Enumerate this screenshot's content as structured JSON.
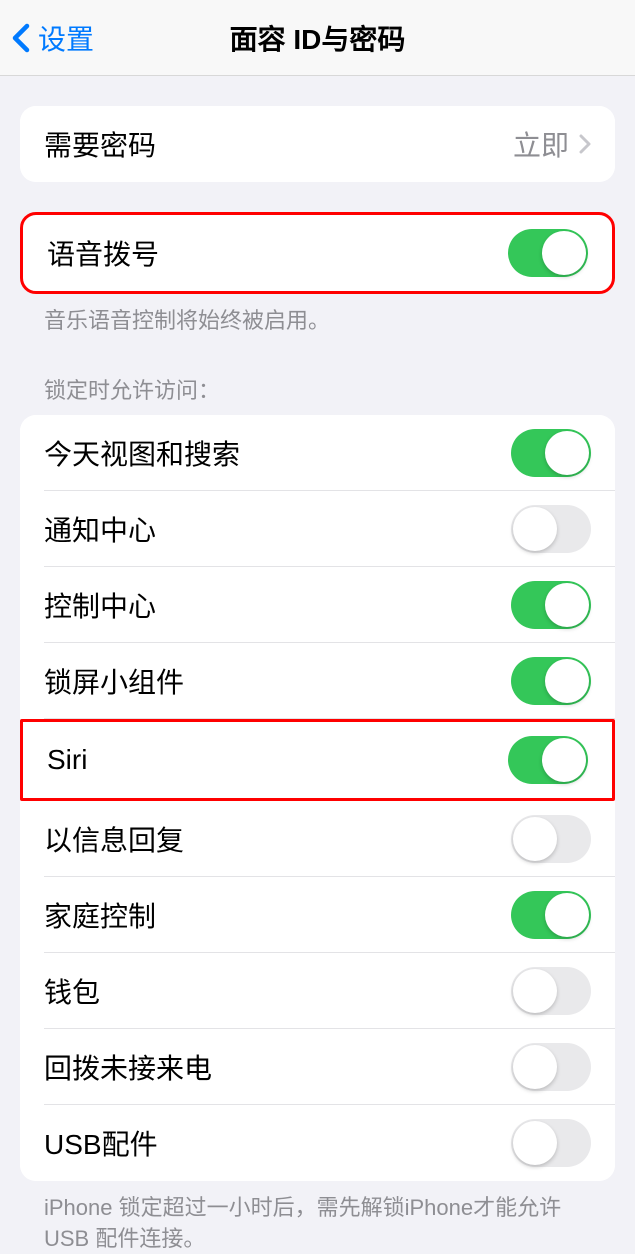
{
  "nav": {
    "back_label": "设置",
    "title": "面容 ID与密码"
  },
  "passcode_row": {
    "label": "需要密码",
    "value": "立即"
  },
  "voice_dial": {
    "label": "语音拨号",
    "footer": "音乐语音控制将始终被启用。",
    "on": true
  },
  "lock_section_header": "锁定时允许访问：",
  "lock_rows": [
    {
      "label": "今天视图和搜索",
      "on": true
    },
    {
      "label": "通知中心",
      "on": false
    },
    {
      "label": "控制中心",
      "on": true
    },
    {
      "label": "锁屏小组件",
      "on": true
    },
    {
      "label": "Siri",
      "on": true
    },
    {
      "label": "以信息回复",
      "on": false
    },
    {
      "label": "家庭控制",
      "on": true
    },
    {
      "label": "钱包",
      "on": false
    },
    {
      "label": "回拨未接来电",
      "on": false
    },
    {
      "label": "USB配件",
      "on": false
    }
  ],
  "usb_footer": "iPhone 锁定超过一小时后，需先解锁iPhone才能允许USB 配件连接。"
}
